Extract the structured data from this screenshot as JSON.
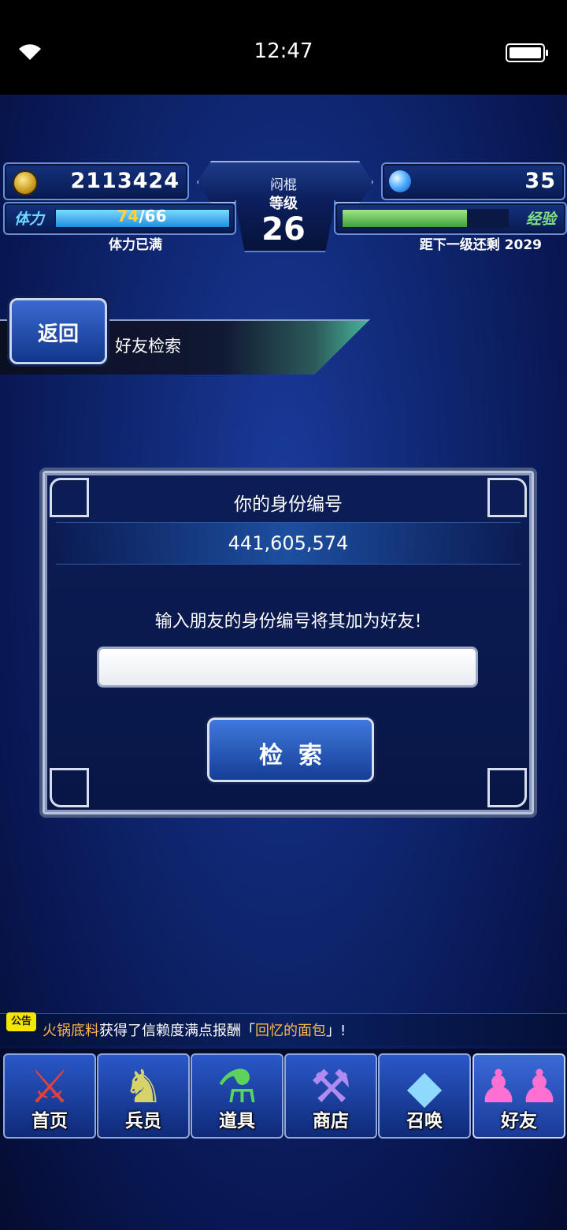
{
  "status_bar": {
    "time": "12:47"
  },
  "hud": {
    "coins": "2113424",
    "gems": "35",
    "player_name": "闷棍",
    "level_label": "等级",
    "level": "26",
    "stamina_label": "体力",
    "stamina_current": "74",
    "stamina_max": "/66",
    "stamina_note": "体力已满",
    "exp_label": "经验",
    "exp_progress": 0.75,
    "exp_note": "距下一级还剩 2029"
  },
  "header": {
    "back_label": "返回",
    "title": "好友检索"
  },
  "dialog": {
    "title": "你的身份编号",
    "id_value": "441,605,574",
    "prompt": "输入朋友的身份编号将其加为好友!",
    "input_value": "",
    "search_label": "检索"
  },
  "notice": {
    "badge": "公告",
    "player": "火锅底料",
    "text_before": "获得了信赖度满点报酬「",
    "item": "回忆的面包",
    "text_after": "」!"
  },
  "bottom_nav": {
    "items": [
      {
        "label": "首页",
        "icon": "sword-icon"
      },
      {
        "label": "兵员",
        "icon": "warrior-icon"
      },
      {
        "label": "道具",
        "icon": "potion-icon"
      },
      {
        "label": "商店",
        "icon": "shop-icon"
      },
      {
        "label": "召唤",
        "icon": "crystal-icon"
      },
      {
        "label": "好友",
        "icon": "friends-icon"
      }
    ]
  }
}
